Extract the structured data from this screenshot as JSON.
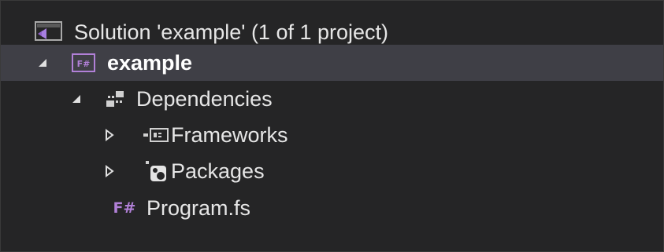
{
  "tree": {
    "solution": {
      "label": "Solution 'example' (1 of 1 project)",
      "icon": "visual-studio-solution-icon"
    },
    "project": {
      "label": "example",
      "icon": "fsharp-project-icon",
      "icon_text": "F#",
      "expanded": true,
      "selected": true
    },
    "dependencies": {
      "label": "Dependencies",
      "icon": "dependencies-icon",
      "expanded": true
    },
    "frameworks": {
      "label": "Frameworks",
      "icon": "frameworks-icon",
      "expanded": false
    },
    "packages": {
      "label": "Packages",
      "icon": "nuget-packages-icon",
      "expanded": false
    },
    "program": {
      "label": "Program.fs",
      "icon": "fsharp-file-icon",
      "icon_text": "F#"
    }
  },
  "colors": {
    "background": "#252526",
    "selected_row": "#3f3f46",
    "text": "#e6e6e6",
    "fsharp_purple": "#b180d7",
    "solution_icon_blue": "#6aa8d8"
  }
}
